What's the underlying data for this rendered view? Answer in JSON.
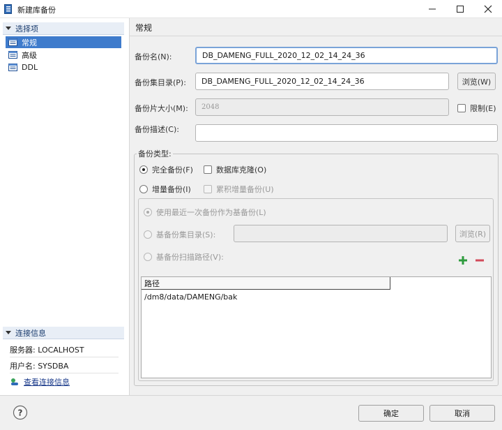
{
  "window": {
    "title": "新建库备份",
    "controls": {
      "minimize_icon": "minimize-icon",
      "maximize_icon": "maximize-icon",
      "close_icon": "close-icon"
    }
  },
  "sidebar": {
    "options_header": "选择项",
    "items": [
      {
        "label": "常规",
        "selected": true,
        "icon": "page-icon"
      },
      {
        "label": "高级",
        "selected": false,
        "icon": "page-icon"
      },
      {
        "label": "DDL",
        "selected": false,
        "icon": "page-icon"
      }
    ],
    "connection_header": "连接信息",
    "server": "服务器: LOCALHOST",
    "user": "用户名: SYSDBA",
    "view_connection_link": "查看连接信息"
  },
  "form": {
    "section_title": "常规",
    "backup_name_label": "备份名(N):",
    "backup_name_value": "DB_DAMENG_FULL_2020_12_02_14_24_36",
    "backup_dir_label": "备份集目录(P):",
    "backup_dir_value": "DB_DAMENG_FULL_2020_12_02_14_24_36",
    "browse_label": "浏览(W)",
    "piece_size_label": "备份片大小(M):",
    "piece_size_value": "2048",
    "limit_label": "限制(E)",
    "description_label": "备份描述(C):",
    "description_value": "",
    "backup_type_label": "备份类型:",
    "full_backup_label": "完全备份(F)",
    "db_clone_label": "数据库克隆(O)",
    "incremental_label": "增量备份(I)",
    "cumulative_label": "累积增量备份(U)",
    "use_last_label": "使用最近一次备份作为基备份(L)",
    "base_dir_label": "基备份集目录(S):",
    "base_dir_value": "",
    "base_browse_label": "浏览(R)",
    "scan_path_label": "基备份扫描路径(V):",
    "path_column": "路径",
    "paths": [
      "/dm8/data/DAMENG/bak"
    ]
  },
  "footer": {
    "ok_label": "确定",
    "cancel_label": "取消",
    "help_icon": "help-icon"
  },
  "colors": {
    "accent": "#3e7bcc",
    "panel": "#f0f0f0",
    "add_icon": "#2e9b3e",
    "remove_icon": "#d24a5a"
  }
}
